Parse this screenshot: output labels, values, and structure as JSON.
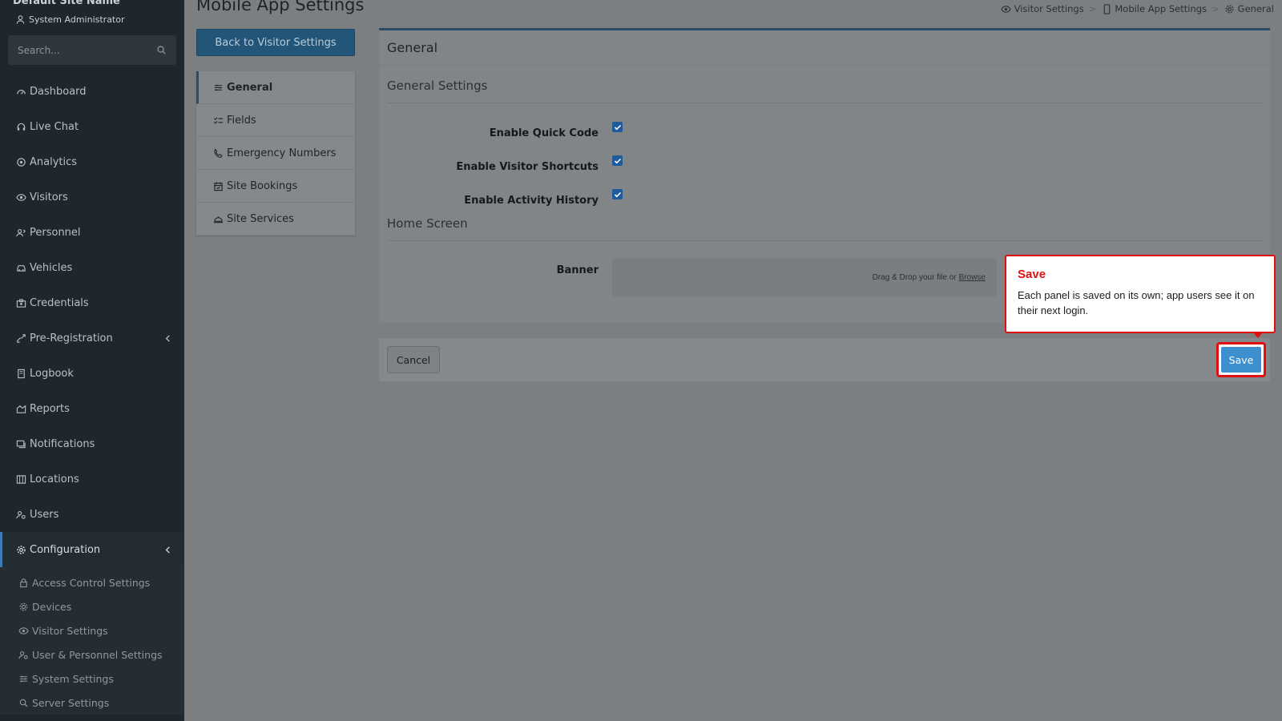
{
  "sidebar": {
    "site_name": "Default Site Name",
    "user_role": "System Administrator",
    "search_placeholder": "Search...",
    "items": [
      {
        "label": "Dashboard",
        "icon": "dashboard-icon"
      },
      {
        "label": "Live Chat",
        "icon": "headset-icon"
      },
      {
        "label": "Analytics",
        "icon": "analytics-icon"
      },
      {
        "label": "Visitors",
        "icon": "eye-icon"
      },
      {
        "label": "Personnel",
        "icon": "personnel-icon"
      },
      {
        "label": "Vehicles",
        "icon": "car-icon"
      },
      {
        "label": "Credentials",
        "icon": "badge-icon"
      },
      {
        "label": "Pre-Registration",
        "icon": "arrows-icon"
      },
      {
        "label": "Logbook",
        "icon": "book-icon"
      },
      {
        "label": "Reports",
        "icon": "report-icon"
      },
      {
        "label": "Notifications",
        "icon": "notification-icon"
      },
      {
        "label": "Locations",
        "icon": "map-icon"
      },
      {
        "label": "Users",
        "icon": "users-icon"
      },
      {
        "label": "Configuration",
        "icon": "gear-icon"
      }
    ],
    "config_sub": [
      {
        "label": "Access Control Settings",
        "icon": "lock-icon"
      },
      {
        "label": "Devices",
        "icon": "device-icon"
      },
      {
        "label": "Visitor Settings",
        "icon": "eye-icon"
      },
      {
        "label": "User & Personnel Settings",
        "icon": "users-icon"
      },
      {
        "label": "System Settings",
        "icon": "sliders-icon"
      },
      {
        "label": "Server Settings",
        "icon": "server-icon"
      }
    ]
  },
  "header": {
    "title": "Mobile App Settings",
    "breadcrumb": [
      "Visitor Settings",
      "Mobile App Settings",
      "General"
    ],
    "breadcrumb_sep": ">"
  },
  "subnav": {
    "back_label": "Back to Visitor Settings",
    "items": [
      {
        "label": "General",
        "icon": "sliders-icon"
      },
      {
        "label": "Fields",
        "icon": "checklist-icon"
      },
      {
        "label": "Emergency Numbers",
        "icon": "phone-icon"
      },
      {
        "label": "Site Bookings",
        "icon": "calendar-icon"
      },
      {
        "label": "Site Services",
        "icon": "service-bell-icon"
      }
    ]
  },
  "panel": {
    "title": "General",
    "general_settings_title": "General Settings",
    "fields": [
      {
        "label": "Enable Quick Code",
        "checked": true
      },
      {
        "label": "Enable Visitor Shortcuts",
        "checked": true
      },
      {
        "label": "Enable Activity History",
        "checked": true
      }
    ],
    "home_screen_title": "Home Screen",
    "banner_label": "Banner",
    "dropzone_text": "Drag & Drop your file or",
    "dropzone_link": "Browse"
  },
  "footer": {
    "cancel_label": "Cancel",
    "save_label": "Save"
  },
  "tooltip": {
    "title": "Save",
    "body": "Each panel is saved on its own; app users see it on their next login."
  },
  "colors": {
    "sidebar_bg": "#1e272d",
    "accent_blue": "#3d8fce",
    "highlight_red": "#e01010"
  }
}
